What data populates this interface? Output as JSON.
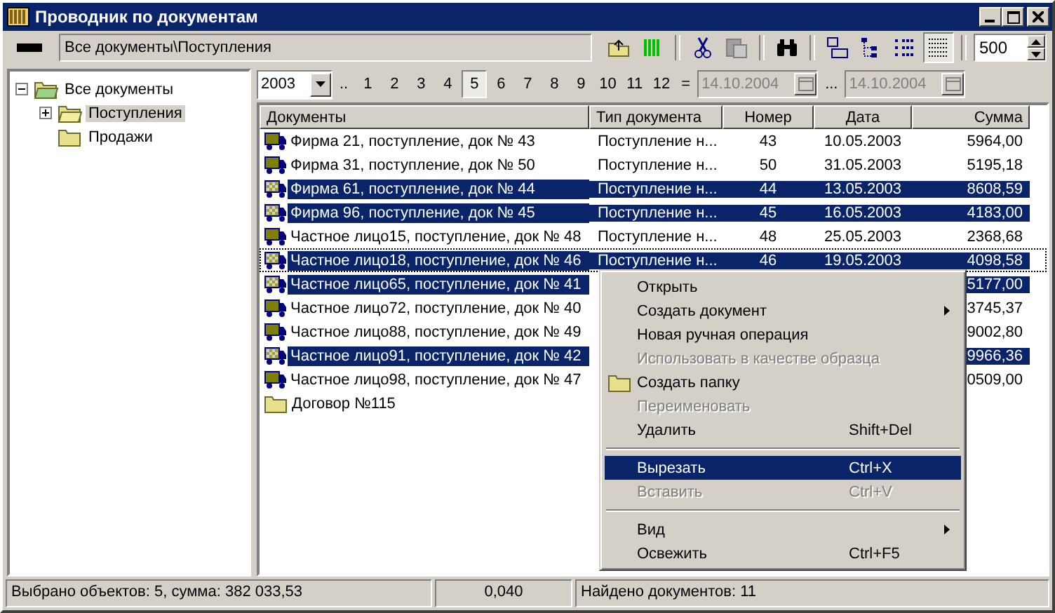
{
  "window": {
    "title": "Проводник по документам"
  },
  "toolbar": {
    "path": "Все документы\\Поступления",
    "count": "500"
  },
  "tree": [
    {
      "label": "Все документы",
      "expanded": true,
      "selected": false,
      "children": [
        {
          "label": "Поступления",
          "expanded": false,
          "selected": true
        },
        {
          "label": "Продажи",
          "selected": false
        }
      ]
    }
  ],
  "period": {
    "year": "2003",
    "prefix": "..",
    "months": [
      {
        "label": "1",
        "selected": false
      },
      {
        "label": "2",
        "selected": false
      },
      {
        "label": "3",
        "selected": false
      },
      {
        "label": "4",
        "selected": false
      },
      {
        "label": "5",
        "selected": true
      },
      {
        "label": "6",
        "selected": false
      },
      {
        "label": "7",
        "selected": false
      },
      {
        "label": "8",
        "selected": false
      },
      {
        "label": "9",
        "selected": false
      },
      {
        "label": "10",
        "selected": false
      },
      {
        "label": "11",
        "selected": false
      },
      {
        "label": "12",
        "selected": false
      }
    ],
    "equals": "=",
    "date_from": "14.10.2004",
    "range_sep": "...",
    "date_to": "14.10.2004"
  },
  "table": {
    "columns": [
      "Документы",
      "Тип документа",
      "Номер",
      "Дата",
      "Сумма"
    ],
    "rows": [
      {
        "kind": "document",
        "name": "Фирма 21, поступление, док № 43",
        "type": "Поступление н...",
        "number": "43",
        "date": "10.05.2003",
        "sum": "5964,00",
        "selected": false,
        "focused": false
      },
      {
        "kind": "document",
        "name": "Фирма 31, поступление, док № 50",
        "type": "Поступление н...",
        "number": "50",
        "date": "31.05.2003",
        "sum": "5195,18",
        "selected": false,
        "focused": false
      },
      {
        "kind": "document",
        "name": "Фирма 61, поступление, док № 44",
        "type": "Поступление н...",
        "number": "44",
        "date": "13.05.2003",
        "sum": "8608,59",
        "selected": true,
        "focused": false
      },
      {
        "kind": "document",
        "name": "Фирма 96, поступление, док № 45",
        "type": "Поступление н...",
        "number": "45",
        "date": "16.05.2003",
        "sum": "4183,00",
        "selected": true,
        "focused": false
      },
      {
        "kind": "document",
        "name": "Частное лицо15, поступление, док № 48",
        "type": "Поступление н...",
        "number": "48",
        "date": "25.05.2003",
        "sum": "2368,68",
        "selected": false,
        "focused": false
      },
      {
        "kind": "document",
        "name": "Частное лицо18, поступление, док № 46",
        "type": "Поступление н...",
        "number": "46",
        "date": "19.05.2003",
        "sum": "4098,58",
        "selected": true,
        "focused": true
      },
      {
        "kind": "document",
        "name": "Частное лицо65, поступление, док № 41",
        "sum": "5177,00",
        "selected": true,
        "focused": false
      },
      {
        "kind": "document",
        "name": "Частное лицо72, поступление, док № 40",
        "sum": "3745,37",
        "selected": false,
        "focused": false
      },
      {
        "kind": "document",
        "name": "Частное лицо88, поступление, док № 49",
        "sum": "9002,80",
        "selected": false,
        "focused": false
      },
      {
        "kind": "document",
        "name": "Частное лицо91, поступление, док № 42",
        "sum": "9966,36",
        "selected": true,
        "focused": false
      },
      {
        "kind": "document",
        "name": "Частное лицо98, поступление, док № 47",
        "sum": "0509,00",
        "selected": false,
        "focused": false
      },
      {
        "kind": "folder",
        "name": "Договор №115",
        "selected": false,
        "focused": false
      }
    ]
  },
  "context_menu": [
    {
      "kind": "item",
      "label": "Открыть",
      "disabled": false,
      "selected": false,
      "submenu": false
    },
    {
      "kind": "item",
      "label": "Создать документ",
      "disabled": false,
      "selected": false,
      "submenu": true
    },
    {
      "kind": "item",
      "label": "Новая ручная операция",
      "disabled": false,
      "selected": false,
      "submenu": false
    },
    {
      "kind": "item",
      "label": "Использовать в качестве образца",
      "disabled": true,
      "selected": false,
      "submenu": false
    },
    {
      "kind": "folder_item",
      "label": "Создать папку",
      "disabled": false,
      "selected": false,
      "submenu": false
    },
    {
      "kind": "item",
      "label": "Переименовать",
      "disabled": true,
      "selected": false,
      "submenu": false
    },
    {
      "kind": "item",
      "label": "Удалить",
      "shortcut": "Shift+Del",
      "disabled": false,
      "selected": false,
      "submenu": false
    },
    {
      "kind": "separator"
    },
    {
      "kind": "item",
      "label": "Вырезать",
      "shortcut": "Ctrl+X",
      "disabled": false,
      "selected": true,
      "submenu": false
    },
    {
      "kind": "item",
      "label": "Вставить",
      "shortcut": "Ctrl+V",
      "disabled": true,
      "selected": false,
      "submenu": false
    },
    {
      "kind": "separator"
    },
    {
      "kind": "item",
      "label": "Вид",
      "disabled": false,
      "selected": false,
      "submenu": true
    },
    {
      "kind": "item",
      "label": "Освежить",
      "shortcut": "Ctrl+F5",
      "disabled": false,
      "selected": false,
      "submenu": false
    }
  ],
  "status_bar": {
    "selection": "Выбрано объектов: 5, сумма: 382 033,53",
    "value": "0,040",
    "found": "Найдено документов: 11"
  }
}
